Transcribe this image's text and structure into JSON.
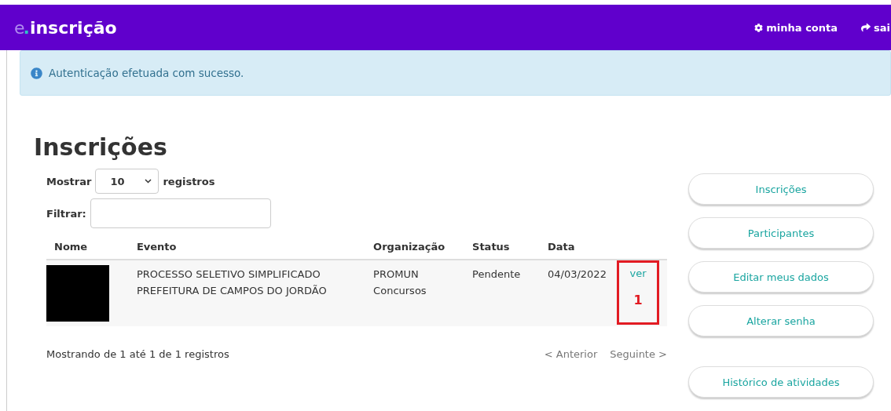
{
  "header": {
    "logo": {
      "prefix": "e",
      "dot": ".",
      "name": "inscrição"
    },
    "links": [
      {
        "kind": "gear",
        "label": "minha conta"
      },
      {
        "kind": "exit",
        "label": "sai"
      }
    ]
  },
  "alert": {
    "text": "Autenticação efetuada com sucesso."
  },
  "title": "Inscrições",
  "controls": {
    "show_label": "Mostrar",
    "page_size": "10",
    "records_label": "registros",
    "filter_label": "Filtrar:"
  },
  "table": {
    "columns": [
      "Nome",
      "Evento",
      "Organização",
      "Status",
      "Data"
    ],
    "rows": [
      {
        "redacted": true,
        "event": "PROCESSO SELETIVO SIMPLIFICADO PREFEITURA DE CAMPOS DO JORDÃO",
        "organization": "PROMUN Concursos",
        "status": "Pendente",
        "date": "04/03/2022",
        "action": "ver",
        "annotation": "1"
      }
    ]
  },
  "footer": {
    "info": "Mostrando de 1 até 1 de 1 registros",
    "pager": [
      {
        "label": "< Anterior",
        "disabled": true
      },
      {
        "label": "Seguinte >",
        "disabled": true
      }
    ]
  },
  "sidebar": {
    "groups": [
      [
        "Inscrições",
        "Participantes",
        "Editar meus dados",
        "Alterar senha"
      ],
      [
        "Histórico de atividades"
      ]
    ]
  }
}
